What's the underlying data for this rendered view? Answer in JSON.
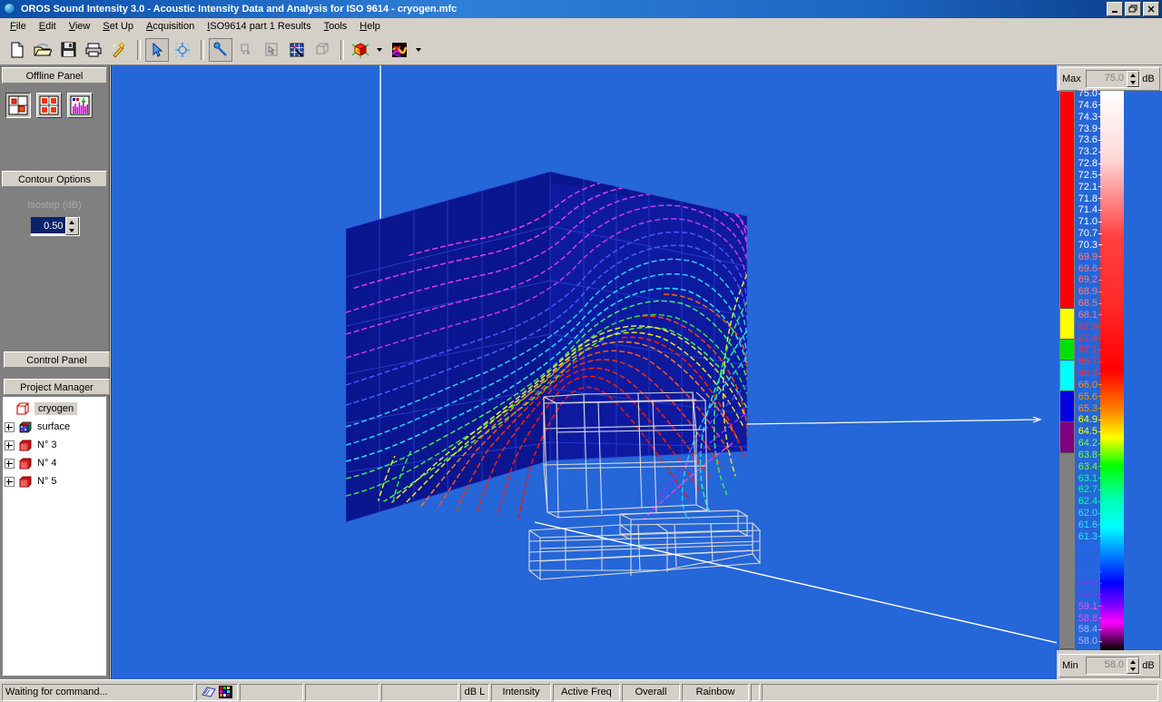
{
  "window": {
    "title": "OROS Sound Intensity 3.0 - Acoustic Intensity Data and Analysis for ISO 9614 - cryogen.mfc",
    "icon": "globe-icon",
    "minimize_label": "_",
    "restore_label": "❐",
    "close_label": "✕"
  },
  "menubar": {
    "items": [
      {
        "label": "File",
        "accel": "F"
      },
      {
        "label": "Edit",
        "accel": "E"
      },
      {
        "label": "View",
        "accel": "V"
      },
      {
        "label": "Set Up",
        "accel": "S"
      },
      {
        "label": "Acquisition",
        "accel": "A"
      },
      {
        "label": "ISO9614 part 1 Results",
        "accel": "I"
      },
      {
        "label": "Tools",
        "accel": "T"
      },
      {
        "label": "Help",
        "accel": "H"
      }
    ]
  },
  "toolbar": {
    "buttons": [
      {
        "name": "new-file-button",
        "icon": "new-document-icon",
        "pressed": false
      },
      {
        "name": "open-file-button",
        "icon": "open-folder-icon",
        "pressed": false
      },
      {
        "name": "save-file-button",
        "icon": "floppy-disk-icon",
        "pressed": false
      },
      {
        "name": "print-button",
        "icon": "printer-icon",
        "pressed": false
      },
      {
        "name": "wizard-button",
        "icon": "magic-wand-icon",
        "pressed": false
      },
      {
        "name": "select-pointer-button",
        "icon": "arrow-pointer-icon",
        "pressed": true
      },
      {
        "name": "target-picker-button",
        "icon": "crosshair-target-icon",
        "pressed": false
      },
      {
        "name": "probe-pointer-button",
        "icon": "probe-pin-icon",
        "pressed": true
      },
      {
        "name": "rotate-view-button",
        "icon": "rotate-hand-icon",
        "pressed": false
      },
      {
        "name": "pan-view-button",
        "icon": "pan-arrow-icon",
        "pressed": false
      },
      {
        "name": "grid-select-button",
        "icon": "grid-pick-icon",
        "pressed": false
      },
      {
        "name": "wireframe-cube-button",
        "icon": "wireframe-cube-icon",
        "pressed": false
      },
      {
        "name": "surface-mesh-button",
        "icon": "colored-cube-icon",
        "pressed": false
      },
      {
        "name": "colormap-button",
        "icon": "color-palette-icon",
        "pressed": false
      }
    ]
  },
  "left_panel": {
    "offline_panel_title": "Offline Panel",
    "offline_buttons": [
      {
        "name": "single-map-button",
        "icon": "single-map-icon"
      },
      {
        "name": "quad-map-button",
        "icon": "quad-map-icon"
      },
      {
        "name": "spectrum-button",
        "icon": "spectrum-chart-icon"
      }
    ],
    "contour_options_title": "Contour Options",
    "isostep_label": "Isostep (dB)",
    "isostep_value": "0.50",
    "control_panel_title": "Control Panel",
    "project_manager_title": "Project Manager",
    "tree": [
      {
        "label": "cryogen",
        "icon": "cube-outline-icon",
        "expandable": false,
        "selected": true,
        "level": 0
      },
      {
        "label": "surface",
        "icon": "color-cube-icon",
        "expandable": true,
        "selected": false,
        "level": 1
      },
      {
        "label": "N° 3",
        "icon": "red-mesh-cube-icon",
        "expandable": true,
        "selected": false,
        "level": 1
      },
      {
        "label": "N° 4",
        "icon": "red-mesh-cube-icon",
        "expandable": true,
        "selected": false,
        "level": 1
      },
      {
        "label": "N° 5",
        "icon": "red-mesh-cube-icon",
        "expandable": true,
        "selected": false,
        "level": 1
      }
    ]
  },
  "scale_panel": {
    "max_label": "Max",
    "max_value": "75.0",
    "max_unit": "dB",
    "min_label": "Min",
    "min_value": "58.0",
    "min_unit": "dB",
    "colormap_name": "Rainbow",
    "tick_labels": [
      "75.0",
      "74.6",
      "74.3",
      "73.9",
      "73.6",
      "73.2",
      "72.8",
      "72.5",
      "72.1",
      "71.8",
      "71.4",
      "71.0",
      "70.7",
      "70.3",
      "69.9",
      "69.6",
      "69.2",
      "68.9",
      "68.5",
      "68.1",
      "67.8",
      "67.4",
      "67.1",
      "66.7",
      "66.3",
      "66.0",
      "65.6",
      "65.3",
      "64.9",
      "64.5",
      "64.2",
      "63.8",
      "63.4",
      "63.1",
      "62.7",
      "62.4",
      "62.0",
      "61.6",
      "61.3",
      "60.9",
      "60.6",
      "60.2",
      "59.8",
      "59.5",
      "59.1",
      "58.8",
      "58.4",
      "58.0"
    ],
    "discrete_swatches": [
      {
        "color": "#ff0000",
        "weight": 21
      },
      {
        "color": "#ffff00",
        "weight": 3
      },
      {
        "color": "#00e000",
        "weight": 2
      },
      {
        "color": "#00ffff",
        "weight": 3
      },
      {
        "color": "#0000e0",
        "weight": 3
      },
      {
        "color": "#800080",
        "weight": 3
      },
      {
        "color": "#808080",
        "weight": 19
      }
    ],
    "gradient_stops": [
      {
        "pos": 0,
        "color": "#ffffff"
      },
      {
        "pos": 12,
        "color": "#ffd9d9"
      },
      {
        "pos": 26,
        "color": "#ff4040"
      },
      {
        "pos": 38,
        "color": "#ff2a2a"
      },
      {
        "pos": 50,
        "color": "#ff0000"
      },
      {
        "pos": 57,
        "color": "#ff8000"
      },
      {
        "pos": 62,
        "color": "#ffff00"
      },
      {
        "pos": 67,
        "color": "#00ff00"
      },
      {
        "pos": 73,
        "color": "#00ffb0"
      },
      {
        "pos": 78,
        "color": "#00ffff"
      },
      {
        "pos": 83,
        "color": "#0080ff"
      },
      {
        "pos": 88,
        "color": "#0000ff"
      },
      {
        "pos": 92,
        "color": "#8000ff"
      },
      {
        "pos": 95,
        "color": "#ff00ff"
      },
      {
        "pos": 100,
        "color": "#000000"
      }
    ]
  },
  "viewport": {
    "background_color": "#2566d8",
    "cube_face_color": "#0a1590",
    "wireframe_color": "#d8d8d8",
    "axis_line_color": "#ffffff",
    "grid_line_color": "#2a3fd0"
  },
  "statusbar": {
    "message": "Waiting for command...",
    "indicator_icons": [
      "book-icon",
      "color-grid-icon"
    ],
    "fields": [
      {
        "name": "status-field-1",
        "label": ""
      },
      {
        "name": "status-field-2",
        "label": ""
      },
      {
        "name": "status-field-3",
        "label": ""
      },
      {
        "name": "status-unit",
        "label": "dB L"
      },
      {
        "name": "status-quantity",
        "label": "Intensity"
      },
      {
        "name": "status-frequency",
        "label": "Active Freq"
      },
      {
        "name": "status-band",
        "label": "Overall"
      },
      {
        "name": "status-palette",
        "label": "Rainbow"
      },
      {
        "name": "status-spare",
        "label": ""
      }
    ]
  }
}
